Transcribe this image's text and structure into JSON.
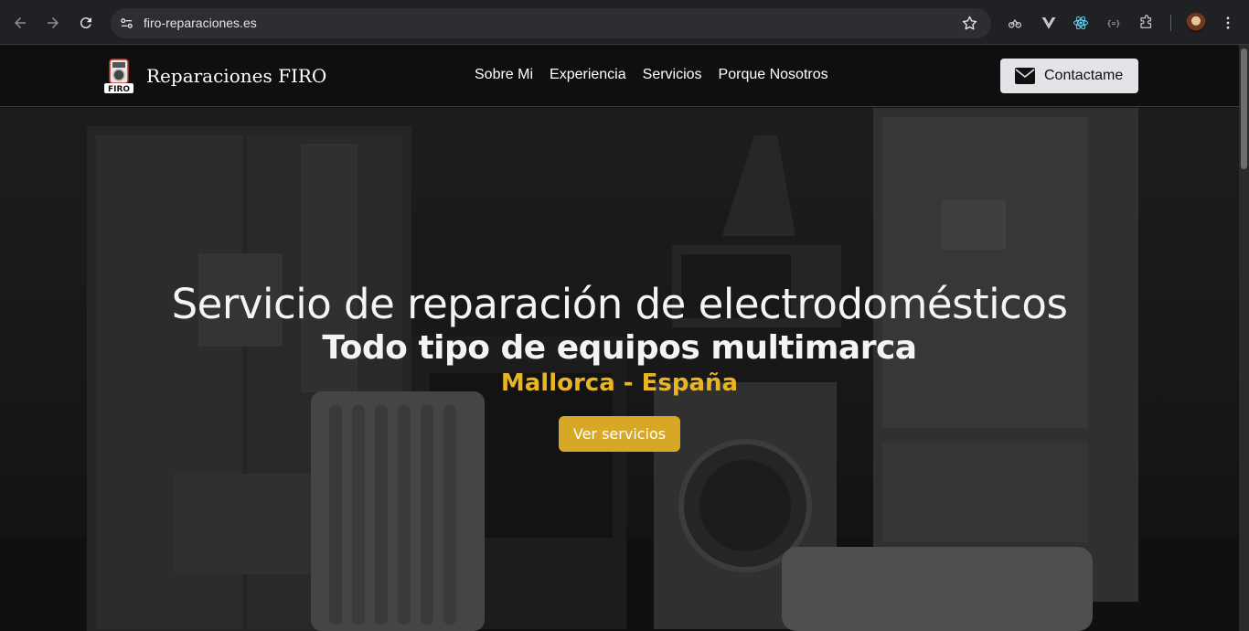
{
  "browser": {
    "url": "firo-reparaciones.es",
    "icons": [
      "back-icon",
      "forward-icon",
      "reload-icon",
      "site-info-icon",
      "star-icon",
      "extension-cloud-icon",
      "vue-extension-icon",
      "react-extension-icon",
      "code-extension-icon",
      "puzzle-icon",
      "menu-icon"
    ]
  },
  "site": {
    "brand": "Reparaciones FIRO",
    "logo_text": "FIRO",
    "nav": [
      "Sobre Mi",
      "Experiencia",
      "Servicios",
      "Porque Nosotros"
    ],
    "contact_label": "Contactame"
  },
  "hero": {
    "title": "Servicio de reparación de electrodomésticos",
    "subtitle": "Todo tipo de equipos multimarca",
    "location": "Mallorca - España",
    "cta": "Ver servicios"
  },
  "colors": {
    "accent": "#d7a826",
    "location_text": "#e8b526",
    "navbar": "#0f0f0f",
    "contact_button": "#e2e4e7"
  }
}
